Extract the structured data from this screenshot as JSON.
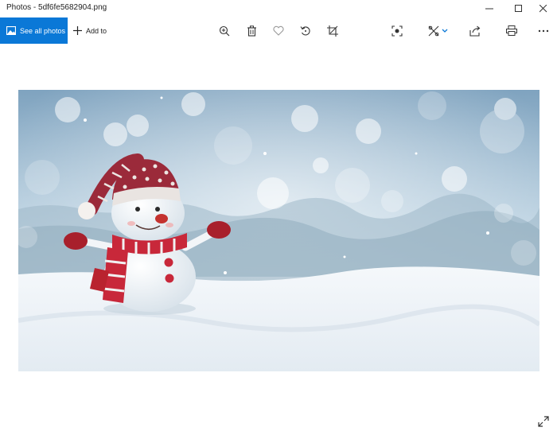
{
  "window": {
    "title": "Photos - 5df6fe5682904.png",
    "minimize_icon": "minimize-icon",
    "maximize_icon": "maximize-icon",
    "close_icon": "close-icon"
  },
  "toolbar": {
    "see_all_label": "See all photos",
    "add_to_label": "Add to",
    "icons": [
      "zoom-in-icon",
      "delete-icon",
      "favorite-icon",
      "rotate-icon",
      "crop-icon",
      "enhance-icon",
      "edit-create-icon",
      "share-icon",
      "print-icon",
      "more-icon"
    ],
    "accent": "#0a78d7"
  },
  "viewer": {
    "image_subject": "snowman",
    "fullscreen_icon": "expand-icon"
  }
}
